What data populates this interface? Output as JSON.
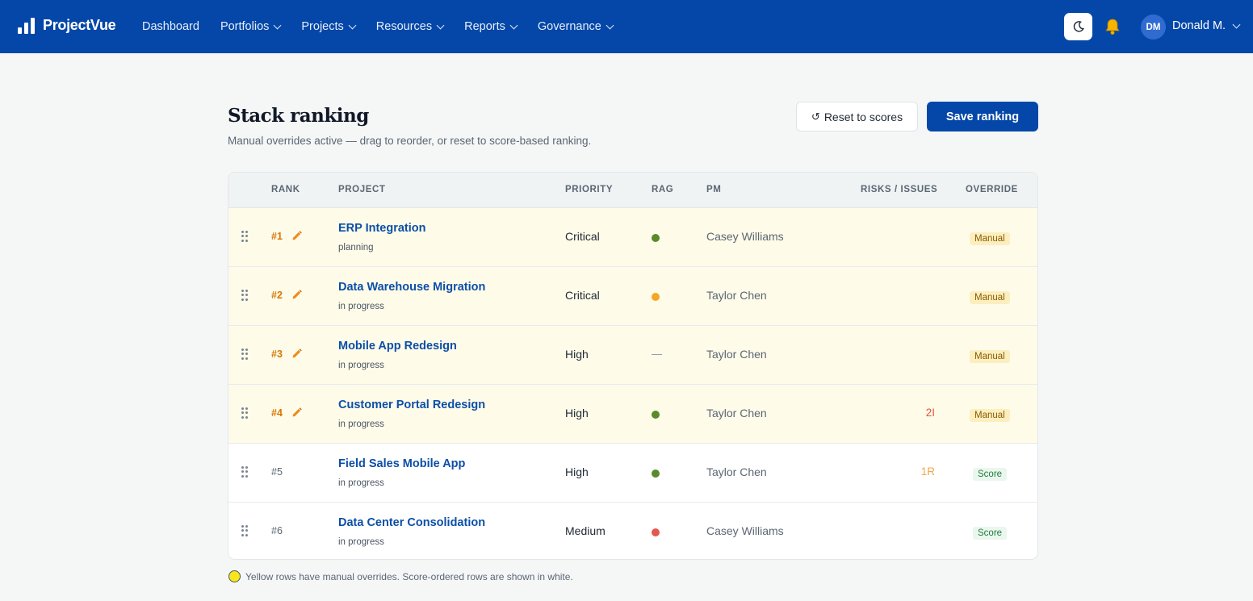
{
  "app": {
    "name": "ProjectVue"
  },
  "nav": {
    "items": [
      {
        "label": "Dashboard",
        "has_menu": false
      },
      {
        "label": "Portfolios",
        "has_menu": true
      },
      {
        "label": "Projects",
        "has_menu": true
      },
      {
        "label": "Resources",
        "has_menu": true
      },
      {
        "label": "Reports",
        "has_menu": true
      },
      {
        "label": "Governance",
        "has_menu": true
      }
    ],
    "user": {
      "initials": "DM",
      "name": "Donald M."
    },
    "icons": {
      "theme": "moon-icon",
      "notifications": "bell-icon"
    }
  },
  "page": {
    "title": "Stack ranking",
    "subtitle": "Manual overrides active — drag to reorder, or reset to score-based ranking.",
    "reset_label": "Reset to scores",
    "save_label": "Save ranking"
  },
  "table": {
    "headers": {
      "rank": "RANK",
      "project": "PROJECT",
      "priority": "PRIORITY",
      "rag": "RAG",
      "pm": "PM",
      "risks": "RISKS / ISSUES",
      "override": "OVERRIDE"
    },
    "rows": [
      {
        "rank": "#1",
        "manual": true,
        "name": "ERP Integration",
        "status": "planning",
        "priority": "Critical",
        "rag": "#5a8a2a",
        "pm": "Casey Williams",
        "risks": "",
        "risk_color": "",
        "override": "Manual"
      },
      {
        "rank": "#2",
        "manual": true,
        "name": "Data Warehouse Migration",
        "status": "in progress",
        "priority": "Critical",
        "rag": "#f5a623",
        "pm": "Taylor Chen",
        "risks": "",
        "risk_color": "",
        "override": "Manual"
      },
      {
        "rank": "#3",
        "manual": true,
        "name": "Mobile App Redesign",
        "status": "in progress",
        "priority": "High",
        "rag": "",
        "rag_text": "—",
        "pm": "Taylor Chen",
        "risks": "",
        "risk_color": "",
        "override": "Manual"
      },
      {
        "rank": "#4",
        "manual": true,
        "name": "Customer Portal Redesign",
        "status": "in progress",
        "priority": "High",
        "rag": "#5a8a2a",
        "pm": "Taylor Chen",
        "risks": "2I",
        "risk_color": "#e5533d",
        "override": "Manual"
      },
      {
        "rank": "#5",
        "manual": false,
        "name": "Field Sales Mobile App",
        "status": "in progress",
        "priority": "High",
        "rag": "#5a8a2a",
        "pm": "Taylor Chen",
        "risks": "1R",
        "risk_color": "#f0a54a",
        "override": "Score"
      },
      {
        "rank": "#6",
        "manual": false,
        "name": "Data Center Consolidation",
        "status": "in progress",
        "priority": "Medium",
        "rag": "#e5574f",
        "pm": "Casey Williams",
        "risks": "",
        "risk_color": "",
        "override": "Score"
      }
    ]
  },
  "footnote": "Yellow rows have manual overrides. Score-ordered rows are shown in white."
}
